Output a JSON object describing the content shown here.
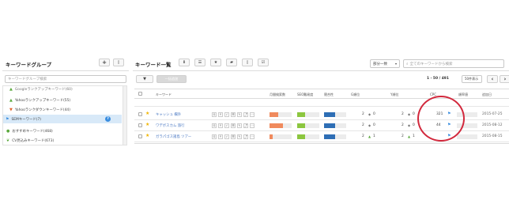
{
  "left_panel": {
    "title": "キーワードグループ",
    "add_label": "+",
    "delete_label": "🗑",
    "search_placeholder": "キーワードグループ検索",
    "groups": [
      {
        "label": "Googleランクアップキーワード(60)",
        "icon": "arrow-up-icon",
        "color": "#5aa83c"
      },
      {
        "label": "Yahooランクアップキーワード(55)",
        "icon": "arrow-up-icon",
        "color": "#5aa83c"
      },
      {
        "label": "Yahooランクダウンキーワード(44)",
        "icon": "arrow-down-icon",
        "color": "#e0642d"
      },
      {
        "label": "SEMキーワード(7)",
        "icon": "flag-icon",
        "color": "#3b8ee0",
        "selected": true,
        "help": "?"
      },
      {
        "label": "おすすめキーワード(468)",
        "icon": "thumb-icon",
        "color": "#5aa83c"
      },
      {
        "label": "CV見込みキーワード(673)",
        "icon": "leaf-icon",
        "color": "#5aa83c"
      }
    ]
  },
  "right_panel": {
    "title": "キーワード一覧",
    "toolbar_icons": [
      "download-icon",
      "list-icon",
      "star-icon",
      "folder-icon",
      "trash-icon",
      "checklist-icon"
    ],
    "filter_select": "部分一致",
    "search_placeholder": "全てのキーワードから検索",
    "filter_icon": "filter-icon",
    "disabled_button": "一括追加",
    "pagination": "1 - 50 / 491",
    "per_page": "50件表示",
    "prev": "‹",
    "next": "›"
  },
  "table": {
    "headers": {
      "keyword": "キーワード",
      "volume": "月間検索数",
      "seo": "SEO難易度",
      "competition": "競合性",
      "g_rank": "G順位",
      "y_rank": "Y順位",
      "cpc": "CPC",
      "rate": "順率値",
      "date": "追加日"
    },
    "row_icons": [
      "G",
      "Y",
      "✓",
      "☰",
      "✎",
      "⤴",
      "⋯"
    ],
    "rows": [
      {
        "keyword": "キャッシュ 欄外",
        "g_rank": "2",
        "g_change": "0",
        "y_rank": "2",
        "y_change": "0",
        "cpc": "321",
        "date": "2015-07-25",
        "g_dir": "neutral",
        "y_dir": "neutral",
        "volume": 0.4,
        "seo": 0.35,
        "comp": 0.5
      },
      {
        "keyword": "ワデボスカム 旅行",
        "g_rank": "2",
        "g_change": "0",
        "y_rank": "2",
        "y_change": "0",
        "cpc": "44",
        "date": "2015-08-12",
        "g_dir": "neutral",
        "y_dir": "neutral",
        "volume": 0.6,
        "seo": 0.35,
        "comp": 0.5
      },
      {
        "keyword": "ガラパゴス諸島 ツアー",
        "g_rank": "2",
        "g_change": "1",
        "y_rank": "2",
        "y_change": "1",
        "cpc": "",
        "date": "2015-08-15",
        "g_dir": "up",
        "y_dir": "up",
        "volume": 0.15,
        "seo": 0.35,
        "comp": 0.5
      }
    ]
  },
  "colors": {
    "volume": "#f08a5d",
    "seo": "#8cc63f",
    "competition": "#2e6eb5",
    "highlight_circle": "#d2283c"
  }
}
